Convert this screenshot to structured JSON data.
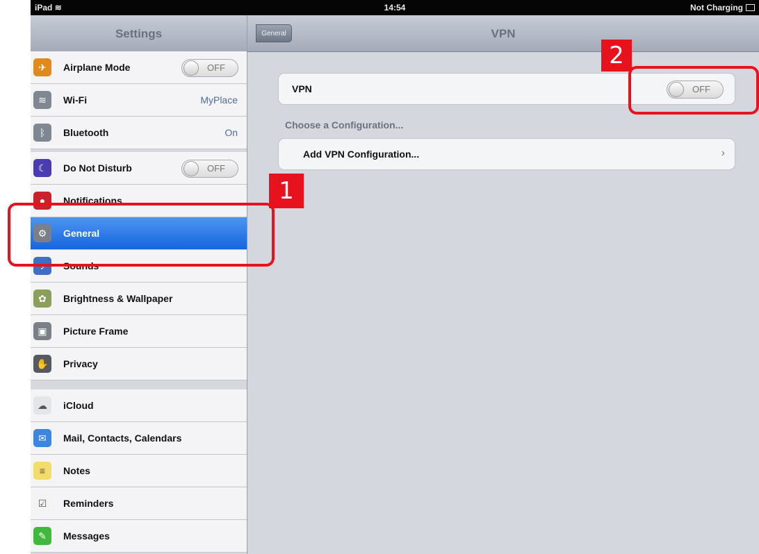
{
  "status_bar": {
    "device": "iPad",
    "wifi_icon": "wifi-icon",
    "time": "14:54",
    "charging": "Not Charging",
    "battery_icon": "battery-icon"
  },
  "master": {
    "title": "Settings",
    "groups": [
      [
        {
          "label": "Airplane Mode",
          "icon": "airplane-icon",
          "icon_color": "#e08a1e",
          "accessory": "switch",
          "value": "OFF"
        },
        {
          "label": "Wi-Fi",
          "icon": "wifi-icon",
          "icon_color": "#7f8792",
          "accessory": "value",
          "value": "MyPlace"
        },
        {
          "label": "Bluetooth",
          "icon": "bluetooth-icon",
          "icon_color": "#7f8792",
          "accessory": "value",
          "value": "On"
        }
      ],
      [
        {
          "label": "Do Not Disturb",
          "icon": "moon-icon",
          "icon_color": "#4b3bb0",
          "accessory": "switch",
          "value": "OFF"
        },
        {
          "label": "Notifications",
          "icon": "notifications-icon",
          "icon_color": "#c9222a"
        },
        {
          "label": "General",
          "icon": "gear-icon",
          "icon_color": "#7a7f88",
          "selected": true
        },
        {
          "label": "Sounds",
          "icon": "speaker-icon",
          "icon_color": "#3d6fc2"
        },
        {
          "label": "Brightness & Wallpaper",
          "icon": "brightness-wallpaper-icon",
          "icon_color": "#8aa05a"
        },
        {
          "label": "Picture Frame",
          "icon": "picture-frame-icon",
          "icon_color": "#7a7f88"
        },
        {
          "label": "Privacy",
          "icon": "hand-icon",
          "icon_color": "#555a62"
        }
      ],
      [
        {
          "label": "iCloud",
          "icon": "cloud-icon",
          "icon_color": "#e3e5e8"
        },
        {
          "label": "Mail, Contacts, Calendars",
          "icon": "mail-icon",
          "icon_color": "#3b86e0"
        },
        {
          "label": "Notes",
          "icon": "notes-icon",
          "icon_color": "#f4dc6a"
        },
        {
          "label": "Reminders",
          "icon": "reminders-icon",
          "icon_color": "#f3f3f3"
        },
        {
          "label": "Messages",
          "icon": "messages-icon",
          "icon_color": "#40b83c"
        }
      ]
    ]
  },
  "detail": {
    "title": "VPN",
    "back_label": "General",
    "vpn_label": "VPN",
    "vpn_switch": "OFF",
    "section_header": "Choose a Configuration...",
    "add_label": "Add VPN Configuration...",
    "chevron": "›"
  },
  "annotations": [
    {
      "number": "1"
    },
    {
      "number": "2"
    }
  ],
  "colors": {
    "annotation_red": "#e8121f",
    "selected_blue": "#1f6fe6"
  }
}
